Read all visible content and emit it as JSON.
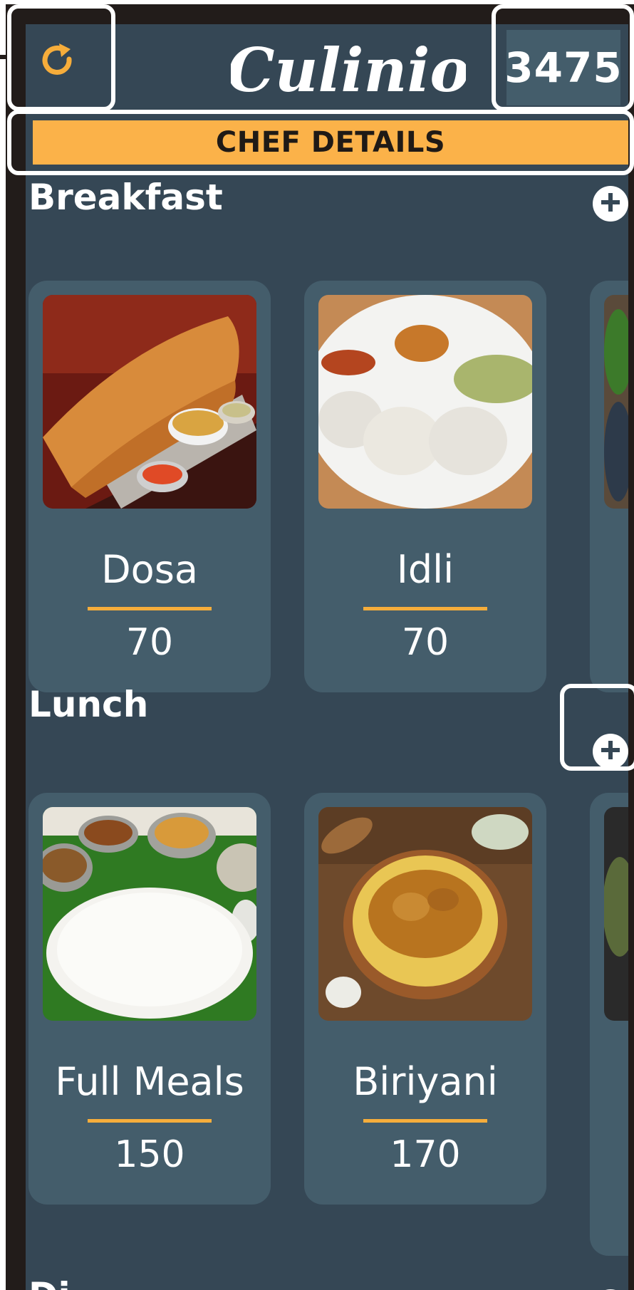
{
  "header": {
    "app_name": "Culinio",
    "score": "3475"
  },
  "chef_details_label": "CHEF DETAILS",
  "sections": [
    {
      "title": "Breakfast",
      "items": [
        {
          "name": "Dosa",
          "price": "70"
        },
        {
          "name": "Idli",
          "price": "70"
        }
      ]
    },
    {
      "title": "Lunch",
      "items": [
        {
          "name": "Full Meals",
          "price": "150"
        },
        {
          "name": "Biriyani",
          "price": "170"
        }
      ]
    },
    {
      "title": "Di"
    }
  ],
  "icons": {
    "refresh": "refresh-icon",
    "add": "plus-circle-icon"
  },
  "colors": {
    "background": "#354755",
    "card": "#445d6b",
    "accent": "#fbb249",
    "refresh_icon": "#f6ad3b"
  }
}
